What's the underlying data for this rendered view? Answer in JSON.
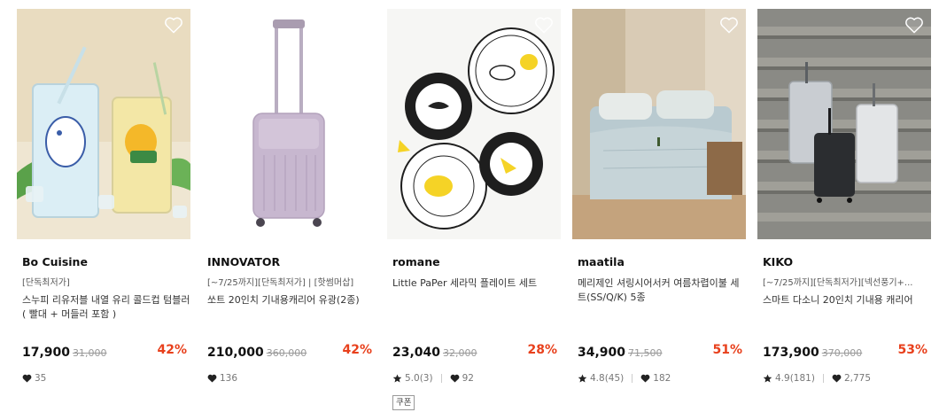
{
  "products": [
    {
      "brand": "Bo Cuisine",
      "promo": "[단독최저가]",
      "name": "스누피 리유저블 내열 유리 콜드컵 텀블러 ( 빨대 + 머들러 포함 )",
      "price": "17,900",
      "original_price": "31,000",
      "discount": "42%",
      "likes": "35"
    },
    {
      "brand": "INNOVATOR",
      "promo": "[~7/25까지][단독최저가] | [핫썸머삽]",
      "name": "쏘트 20인치 기내용캐리어 유광(2종)",
      "price": "210,000",
      "original_price": "360,000",
      "discount": "42%",
      "likes": "136"
    },
    {
      "brand": "romane",
      "name": "Little PaPer 세라믹 플레이트 세트",
      "price": "23,040",
      "original_price": "32,000",
      "discount": "28%",
      "rating": "5.0(3)",
      "likes": "92",
      "coupon": "쿠폰"
    },
    {
      "brand": "maatila",
      "name": "메리제인 셔링시어서커 여름차렵이불 세트(SS/Q/K) 5종",
      "price": "34,900",
      "original_price": "71,500",
      "discount": "51%",
      "rating": "4.8(45)",
      "likes": "182"
    },
    {
      "brand": "KIKO",
      "promo": "[~7/25까지][단독최저가][넥선풍기+...",
      "name": "스마트 다소니 20인치 기내용 캐리어",
      "price": "173,900",
      "original_price": "370,000",
      "discount": "53%",
      "rating": "4.9(181)",
      "likes": "2,775"
    }
  ],
  "icons": {
    "wishlist": "heart-outline-icon",
    "likes": "heart-icon",
    "rating": "star-icon"
  },
  "colors": {
    "discount": "#e8401c",
    "price": "#111111",
    "original_price": "#999999"
  }
}
